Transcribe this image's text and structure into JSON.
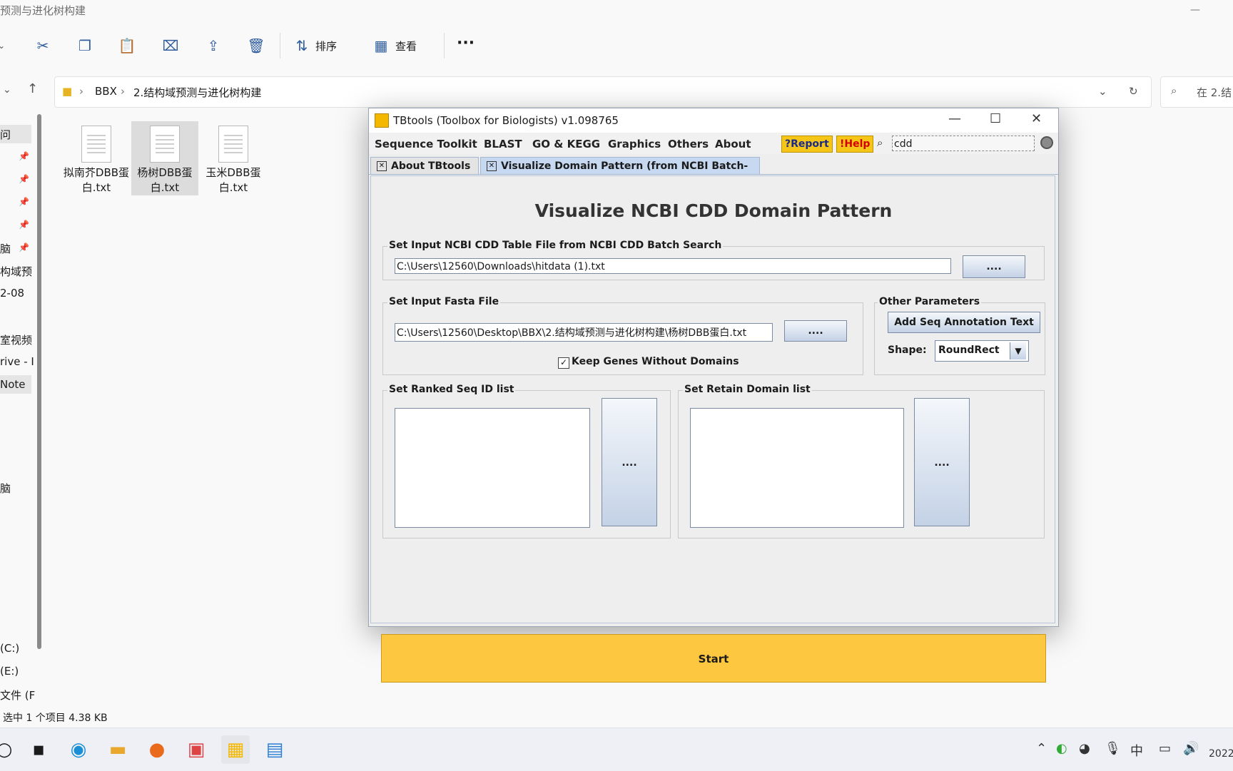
{
  "explorer": {
    "title": "预测与进化树构建",
    "toolbar": {
      "sort_label": "排序",
      "view_label": "查看",
      "more_label": "···"
    },
    "breadcrumb": [
      "BBX",
      "2.结构域预测与进化树构建"
    ],
    "search_placeholder": "在 2.结",
    "nav_items": [
      "问",
      "脑",
      "构域预",
      "2-08",
      "室视频",
      "rive - I",
      "Note",
      "脑",
      "(C:)",
      "(E:)",
      "文件 (F"
    ],
    "files": [
      {
        "name": "拟南芥DBB蛋白.txt"
      },
      {
        "name": "杨树DBB蛋白.txt"
      },
      {
        "name": "玉米DBB蛋白.txt"
      }
    ],
    "status": "选中 1 个项目  4.38 KB"
  },
  "taskbar": {
    "ime": "中",
    "clock": "2022"
  },
  "tbtools": {
    "title": "TBtools (Toolbox for Biologists) v1.098765",
    "menu": [
      "Sequence Toolkit",
      "BLAST",
      "GO & KEGG",
      "Graphics",
      "Others",
      "About"
    ],
    "report_label": "?Report",
    "help_label": "!Help",
    "search_value": "cdd",
    "tabs": [
      "About TBtools",
      "Visualize Domain Pattern (from NCBI Batch-CDD)"
    ],
    "heading": "Visualize NCBI CDD Domain Pattern",
    "cdd_group": {
      "legend": "Set Input NCBI CDD Table File from NCBI CDD Batch Search",
      "path": "C:\\Users\\12560\\Downloads\\hitdata (1).txt",
      "browse_label": "...."
    },
    "fasta_group": {
      "legend": "Set Input Fasta File",
      "path": "C:\\Users\\12560\\Desktop\\BBX\\2.结构域预测与进化树构建\\杨树DBB蛋白.txt",
      "browse_label": "....",
      "checkbox_label": "Keep Genes Without Domains",
      "checkbox_mark": "✓"
    },
    "other_params": {
      "legend": "Other Parameters",
      "annotation_button": "Add Seq Annotation Text",
      "shape_label": "Shape:",
      "shape_value": "RoundRect"
    },
    "ranked_group": {
      "legend": "Set Ranked Seq ID list",
      "browse_label": "...."
    },
    "retain_group": {
      "legend": "Set Retain Domain list",
      "browse_label": "...."
    },
    "start_label": "Start"
  }
}
